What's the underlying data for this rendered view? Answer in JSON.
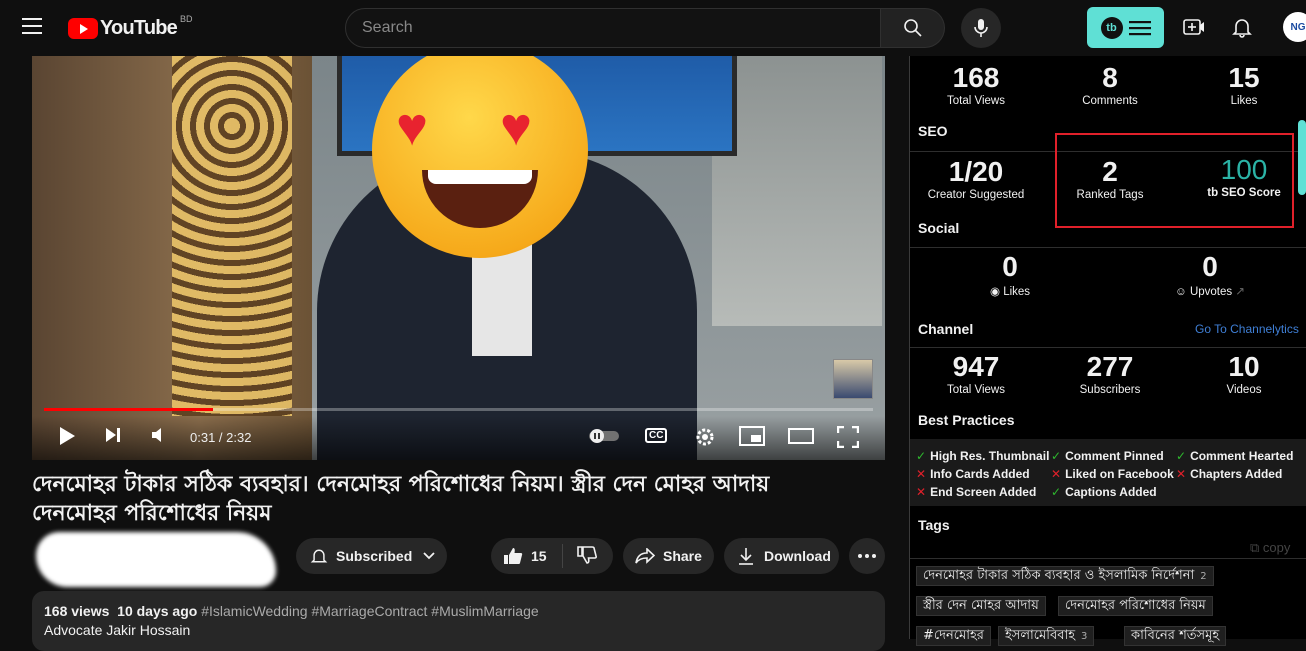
{
  "header": {
    "logo_text": "YouTube",
    "country_code": "BD",
    "search_placeholder": "Search",
    "tb_logo": "tb",
    "avatar_text": "NG"
  },
  "player": {
    "current_time": "0:31",
    "duration": "2:32",
    "time_display": "0:31 / 2:32",
    "progress_fraction": 0.204,
    "cc_label": "CC"
  },
  "video": {
    "title": "দেনমোহর টাকার সঠিক ব্যবহার। দেনমোহর পরিশোধের নিয়ম। স্ত্রীর দেন মোহর আদায় দেনমোহর পরিশোধের নিয়ম",
    "subscribe_label": "Subscribed",
    "likes": "15",
    "share_label": "Share",
    "download_label": "Download",
    "views": "168 views",
    "age": "10 days ago",
    "hashtags": "#IslamicWedding #MarriageContract #MuslimMarriage",
    "desc_line2": "Advocate Jakir Hossain"
  },
  "panel": {
    "top_stats": [
      {
        "num": "168",
        "label": "Total Views"
      },
      {
        "num": "8",
        "label": "Comments"
      },
      {
        "num": "15",
        "label": "Likes"
      }
    ],
    "seo_title": "SEO",
    "seo_stats": [
      {
        "num": "1/20",
        "label": "Creator Suggested"
      },
      {
        "num": "2",
        "label": "Ranked Tags"
      },
      {
        "num": "100",
        "label": "SEO Score"
      }
    ],
    "seo_score_color": "#2bb3a6",
    "social_title": "Social",
    "social_stats": [
      {
        "num": "0",
        "label": "Likes"
      },
      {
        "num": "0",
        "label": "Upvotes"
      }
    ],
    "channel_title": "Channel",
    "channel_link": "Go To Channelytics",
    "channel_stats": [
      {
        "num": "947",
        "label": "Total Views"
      },
      {
        "num": "277",
        "label": "Subscribers"
      },
      {
        "num": "10",
        "label": "Videos"
      }
    ],
    "bp_title": "Best Practices",
    "best_practices": [
      {
        "label": "High Res. Thumbnail",
        "ok": true
      },
      {
        "label": "Comment Pinned",
        "ok": true
      },
      {
        "label": "Comment Hearted",
        "ok": true
      },
      {
        "label": "Info Cards Added",
        "ok": false
      },
      {
        "label": "Liked on Facebook",
        "ok": false
      },
      {
        "label": "Chapters Added",
        "ok": false
      },
      {
        "label": "End Screen Added",
        "ok": false
      },
      {
        "label": "Captions Added",
        "ok": true
      }
    ],
    "tags_title": "Tags",
    "copy_label": "copy",
    "tags": [
      {
        "text": "দেনমোহর টাকার সঠিক ব্যবহার ও ইসলামিক নির্দেশনা",
        "count": "2"
      },
      {
        "text": "স্ত্রীর দেন মোহর আদায়",
        "count": ""
      },
      {
        "text": "দেনমোহর পরিশোধের নিয়ম",
        "count": ""
      },
      {
        "text": "#দেনমোহর",
        "count": ""
      },
      {
        "text": "ইসলামেবিবাহ",
        "count": "3"
      },
      {
        "text": "কাবিনের শর্তসমূহ",
        "count": ""
      }
    ],
    "accent": "#5fe0d5"
  }
}
